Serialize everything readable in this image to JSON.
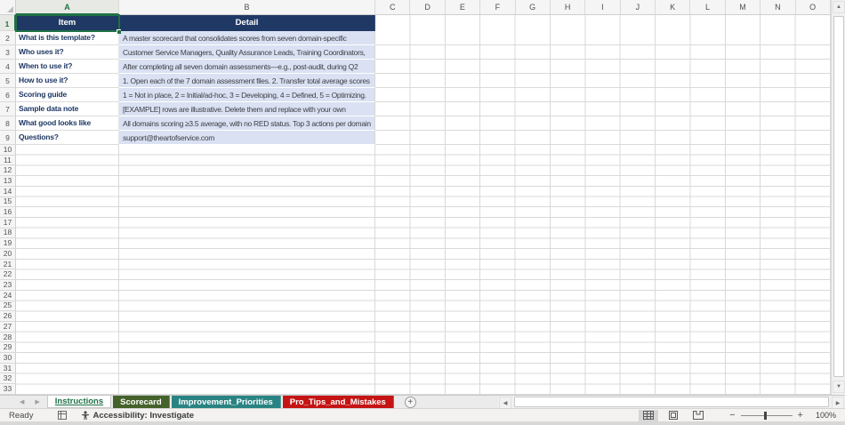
{
  "sheet": {
    "columns": {
      "a": "A",
      "b": "B",
      "rest": [
        "C",
        "D",
        "E",
        "F",
        "G",
        "H",
        "I",
        "J",
        "K",
        "L",
        "M",
        "N",
        "O"
      ]
    },
    "header_row": {
      "number": "1",
      "item": "Item",
      "detail": "Detail"
    },
    "content_rows": [
      {
        "n": "2",
        "item": "What is this template?",
        "detail": "A master scorecard that consolidates scores from seven domain-specific",
        "clipped": true
      },
      {
        "n": "3",
        "item": "Who uses it?",
        "detail": "Customer Service Managers, Quality Assurance Leads, Training Coordinators,",
        "clipped": true
      },
      {
        "n": "4",
        "item": "When to use it?",
        "detail": "After completing all seven domain assessments—e.g., post-audit, during Q2",
        "clipped": true
      },
      {
        "n": "5",
        "item": "How to use it?",
        "detail": "1. Open each of the 7 domain assessment files. 2. Transfer total average scores",
        "clipped": true
      },
      {
        "n": "6",
        "item": "Scoring guide",
        "detail": "1 = Not in place, 2 = Initial/ad-hoc, 3 = Developing, 4 = Defined, 5 = Optimizing.",
        "clipped": true
      },
      {
        "n": "7",
        "item": "Sample data note",
        "detail": "[EXAMPLE] rows are illustrative. Delete them and replace with your own",
        "clipped": true
      },
      {
        "n": "8",
        "item": "What good looks like",
        "detail": "All domains scoring ≥3.5 average, with no RED status. Top 3 actions per domain",
        "clipped": true
      },
      {
        "n": "9",
        "item": "Questions?",
        "detail": "support@theartofservice.com",
        "clipped": false
      }
    ],
    "empty_row_numbers": [
      "10",
      "11",
      "12",
      "13",
      "14",
      "15",
      "16",
      "17",
      "18",
      "19",
      "20",
      "21",
      "22",
      "23",
      "24",
      "25",
      "26",
      "27",
      "28",
      "29",
      "30",
      "31",
      "32",
      "33"
    ]
  },
  "tab_bar": {
    "tabs": [
      {
        "label": "Instructions",
        "active": true
      },
      {
        "label": "Scorecard",
        "bg": "#44622A",
        "fg": "#FFFFFF"
      },
      {
        "label": "Improvement_Priorities",
        "bg": "#2A8383",
        "fg": "#FFFFFF"
      },
      {
        "label": "Pro_Tips_and_Mistakes",
        "bg": "#C51414",
        "fg": "#FFFFFF"
      }
    ],
    "add_sheet_label": "+"
  },
  "status_bar": {
    "ready": "Ready",
    "accessibility": "Accessibility: Investigate",
    "zoom_level": "100%"
  },
  "glyphs": {
    "nav_left": "◀",
    "nav_right": "▶",
    "scroll_up": "▲",
    "scroll_down": "▼",
    "scroll_left": "◀",
    "scroll_right": "▶",
    "tab_dots": "⋮",
    "zoom_minus": "−",
    "zoom_plus": "+"
  },
  "colors": {
    "header_fill": "#1F3864",
    "detail_fill": "#D9E1F2",
    "item_text": "#1F3864",
    "selection_green": "#1E7145",
    "tab_scorecard": "#44622A",
    "tab_improvement": "#2A8383",
    "tab_pro_tips": "#C51414"
  }
}
